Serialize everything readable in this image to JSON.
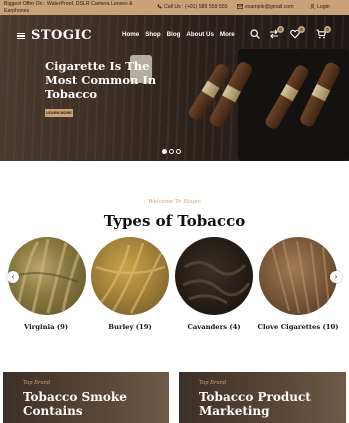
{
  "topbar": {
    "offer": "Biggest Offer On : WaterProof, DSLR Camera Lenses & Earphones",
    "call": "Call Us : (+01) 589 559 555",
    "email": "example@gmail.com",
    "login": "Login"
  },
  "header": {
    "logo": "STOGIC",
    "menu": [
      "Home",
      "Shop",
      "Blog",
      "About Us",
      "More"
    ],
    "compare_count": "0",
    "wishlist_count": "0",
    "cart_count": "0"
  },
  "hero": {
    "title": "Cigarette Is The Most Common In Tobacco",
    "button": "LEARN MORE",
    "slides_total": 3,
    "slide_active": 1
  },
  "types": {
    "welcome": "Welcome To Stogic",
    "title": "Types of Tobacco",
    "prev": "‹",
    "next": "›",
    "items": [
      {
        "label": "Virginia (9)"
      },
      {
        "label": "Burley (19)"
      },
      {
        "label": "Cavanders (4)"
      },
      {
        "label": "Clove Cigarettes (10)"
      }
    ]
  },
  "cards": [
    {
      "tag": "Top Brand",
      "title": "Tobacco Smoke Contains"
    },
    {
      "tag": "Top Brand",
      "title": "Tobacco Product Marketing"
    }
  ],
  "colors": {
    "accent": "#c9a27a",
    "dark": "#2a1a0e"
  }
}
